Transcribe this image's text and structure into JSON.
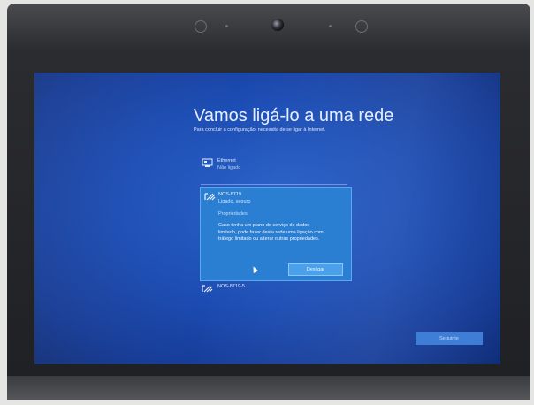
{
  "setup": {
    "title": "Vamos ligá-lo a uma rede",
    "subtitle": "Para concluir a configuração, necessita de se ligar à Internet."
  },
  "networks": [
    {
      "name": "Ethernet",
      "status": "Não ligado",
      "icon": "ethernet-icon"
    },
    {
      "name": "NOS-8719",
      "status": "Ligado, seguro",
      "icon": "wifi-icon",
      "properties_label": "Propriedades",
      "description": "Caso tenha um plano de serviço de dados limitado, pode fazer desta rede uma ligação com tráfego limitado ou alterar outras propriedades.",
      "disconnect_label": "Desligar"
    },
    {
      "name": "NOS-8719-5",
      "icon": "wifi-icon"
    }
  ],
  "footer": {
    "next_label": "Seguinte"
  },
  "colors": {
    "screen_blue": "#1c4db4",
    "selected_blue": "#2b7fd3",
    "button_blue": "#4aa0ea"
  }
}
